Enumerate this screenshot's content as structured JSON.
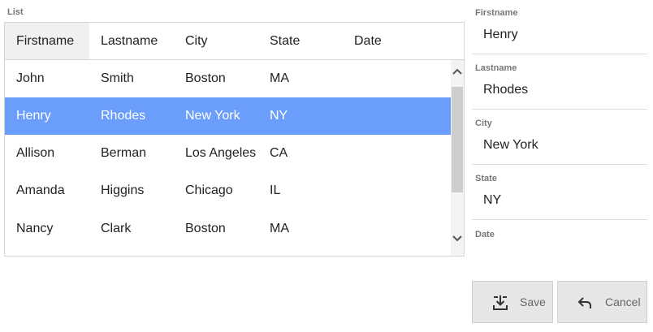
{
  "list_label": "List",
  "columns": [
    "Firstname",
    "Lastname",
    "City",
    "State",
    "Date"
  ],
  "rows": [
    {
      "firstname": "John",
      "lastname": "Smith",
      "city": "Boston",
      "state": "MA",
      "date": ""
    },
    {
      "firstname": "Henry",
      "lastname": "Rhodes",
      "city": "New York",
      "state": "NY",
      "date": ""
    },
    {
      "firstname": "Allison",
      "lastname": "Berman",
      "city": "Los Angeles",
      "state": "CA",
      "date": ""
    },
    {
      "firstname": "Amanda",
      "lastname": "Higgins",
      "city": "Chicago",
      "state": "IL",
      "date": ""
    },
    {
      "firstname": "Nancy",
      "lastname": "Clark",
      "city": "Boston",
      "state": "MA",
      "date": ""
    }
  ],
  "selected_row": 1,
  "form": {
    "firstname_label": "Firstname",
    "firstname_value": "Henry",
    "lastname_label": "Lastname",
    "lastname_value": "Rhodes",
    "city_label": "City",
    "city_value": "New York",
    "state_label": "State",
    "state_value": "NY",
    "date_label": "Date",
    "date_value": ""
  },
  "buttons": {
    "save_label": "Save",
    "cancel_label": "Cancel"
  },
  "colors": {
    "selection": "#6a9dfc",
    "button_bg": "#e6e6e6"
  },
  "icons": {
    "save": "save-download-icon",
    "cancel": "undo-arrow-icon",
    "scroll_up": "chevron-up-icon",
    "scroll_down": "chevron-down-icon"
  }
}
